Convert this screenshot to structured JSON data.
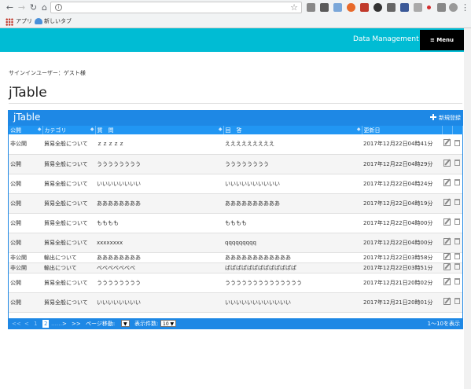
{
  "browser": {
    "bookmarks": [
      "アプリ",
      "新しいタブ"
    ]
  },
  "header": {
    "brand": "Data Management",
    "menu_label": "≡ Menu"
  },
  "signin_text": "サインインユーザー：ゲスト様",
  "page_title": "jTable",
  "jtable": {
    "title": "jTable",
    "add_label": "新規登録",
    "columns": [
      "公開",
      "カテゴリ",
      "質　問",
      "回　答",
      "更新日"
    ],
    "rows": [
      {
        "pub": "非公開",
        "cat": "貿易全般について",
        "q": "ｚｚｚｚｚ",
        "a": "えええええええええ",
        "date": "2017年12月22日04時41分",
        "size": "tall"
      },
      {
        "pub": "公開",
        "cat": "貿易全般について",
        "q": "うううううううう",
        "a": "うううううううう",
        "date": "2017年12月22日04時29分",
        "size": "tall"
      },
      {
        "pub": "公開",
        "cat": "貿易全般について",
        "q": "いいいいいいいい",
        "a": "いいいいいいいいいい",
        "date": "2017年12月22日04時24分",
        "size": "tall"
      },
      {
        "pub": "公開",
        "cat": "貿易全般について",
        "q": "ああああああああ",
        "a": "ああああああああああ",
        "date": "2017年12月22日04時19分",
        "size": "tall"
      },
      {
        "pub": "公開",
        "cat": "貿易全般について",
        "q": "もももも",
        "a": "もももも",
        "date": "2017年12月22日04時00分",
        "size": "tall"
      },
      {
        "pub": "公開",
        "cat": "貿易全般について",
        "q": "xxxxxxxx",
        "a": "qqqqqqqqq",
        "date": "2017年12月22日04時00分",
        "size": "tall"
      },
      {
        "pub": "非公開",
        "cat": "輸出について",
        "q": "ああああああああ",
        "a": "ああああああああああああ",
        "date": "2017年12月22日03時58分",
        "size": "short"
      },
      {
        "pub": "非公開",
        "cat": "輸出について",
        "q": "べべべべべべべ",
        "a": "ぱぱぱぱぱぱぱぱぱぱぱぱぱ",
        "date": "2017年12月22日03時51分",
        "size": "short"
      },
      {
        "pub": "公開",
        "cat": "貿易全般について",
        "q": "うううううううう",
        "a": "うううううううううううううう",
        "date": "2017年12月21日20時02分",
        "size": "tall"
      },
      {
        "pub": "公開",
        "cat": "貿易全般について",
        "q": "いいいいいいいい",
        "a": "いいいいいいいいいいいい",
        "date": "2017年12月21日20時01分",
        "size": "tall"
      }
    ],
    "footer": {
      "first": "<<",
      "prev": "<",
      "page1": "1",
      "page2": "2",
      "next": ">",
      "last": ">>",
      "goto_label": "ページ移動:",
      "goto_value": "",
      "per_page_label": "表示件数:",
      "per_page_value": "10",
      "range": "1～10を表示"
    }
  },
  "colors": {
    "header_bg": "#00bcd4",
    "table_accent": "#1e88e5"
  }
}
